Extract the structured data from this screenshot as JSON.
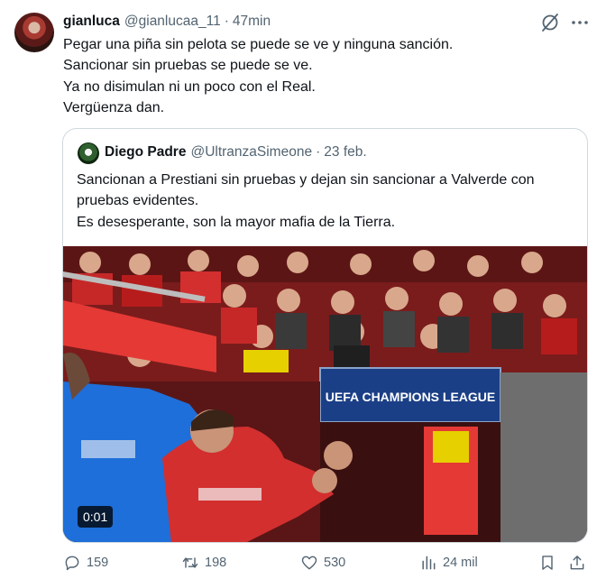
{
  "tweet": {
    "display_name": "gianluca",
    "handle": "@gianlucaa_11",
    "separator": "·",
    "time": "47min",
    "lines": [
      "Pegar una piña sin pelota se puede se ve y ninguna sanción.",
      "Sancionar sin pruebas se puede se ve.",
      "Ya no disimulan ni un poco con el Real.",
      "Vergüenza dan."
    ]
  },
  "quote": {
    "display_name": "Diego Padre",
    "handle": "@UltranzaSimeone",
    "separator": "·",
    "date": "23 feb.",
    "lines": [
      "Sancionan a Prestiani sin pruebas y dejan sin sancionar a Valverde con",
      "pruebas evidentes.",
      "Es desesperante, son la mayor mafia de la Tierra."
    ],
    "media": {
      "duration": "0:01",
      "board_text": "UEFA CHAMPIONS LEAGUE"
    }
  },
  "actions": {
    "replies": "159",
    "reposts": "198",
    "likes": "530",
    "views": "24 mil"
  },
  "icons": {
    "grok": "grok-icon",
    "more": "more-icon",
    "reply": "reply-icon",
    "repost": "repost-icon",
    "like": "like-icon",
    "views": "views-icon",
    "bookmark": "bookmark-icon",
    "share": "share-icon"
  },
  "colors": {
    "text": "#0f1419",
    "muted": "#536471",
    "border": "#cfd9de",
    "board_blue": "#1b3f86"
  }
}
